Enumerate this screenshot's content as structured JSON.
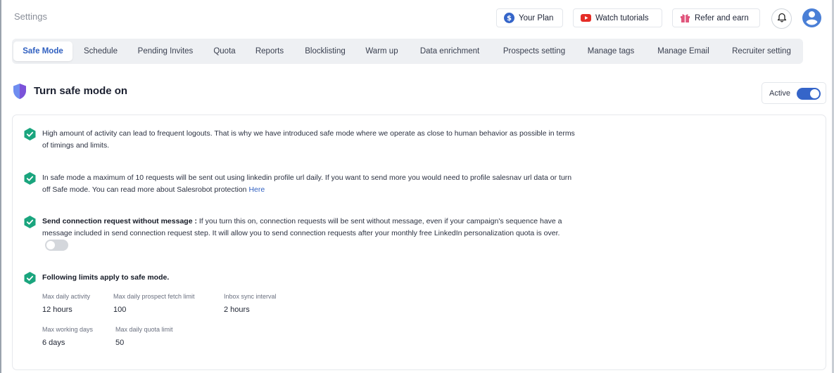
{
  "header": {
    "title": "Settings",
    "your_plan": "Your Plan",
    "watch_tutorials": "Watch tutorials",
    "refer_and_earn": "Refer and earn"
  },
  "tabs": [
    {
      "label": "Safe Mode",
      "active": true
    },
    {
      "label": "Schedule"
    },
    {
      "label": "Pending Invites"
    },
    {
      "label": "Quota"
    },
    {
      "label": "Reports"
    },
    {
      "label": "Blocklisting"
    },
    {
      "label": "Warm up"
    },
    {
      "label": "Data enrichment"
    },
    {
      "label": "Prospects setting"
    },
    {
      "label": "Manage tags"
    },
    {
      "label": "Manage Email"
    },
    {
      "label": "Recruiter setting"
    }
  ],
  "section": {
    "title": "Turn safe mode on",
    "status_label": "Active",
    "status_on": true
  },
  "items": {
    "item1": "High amount of activity can lead to frequent logouts. That is why we have introduced safe mode where we operate as close to human behavior as possible in terms of timings and limits.",
    "item2_text": "In safe mode a maximum of 10 requests will be sent out using linkedin profile url daily. If you want to send more you would need to profile salesnav url data or turn off Safe mode. You can read more about Salesrobot protection",
    "item2_link": "Here",
    "item3_bold": "Send connection request without message :",
    "item3_text": " If you turn this on, connection requests will be sent without message, even if your campaign's sequence have a message included in send connection request step. It will allow you to send connection requests after your monthly free LinkedIn personalization quota is over.",
    "item3_toggle_on": false,
    "item4_title": "Following limits apply to safe mode."
  },
  "limits": {
    "max_daily_activity_label": "Max daily activity",
    "max_daily_activity": "12 hours",
    "max_prospect_fetch_label": "Max daily prospect fetch limit",
    "max_prospect_fetch": "100",
    "inbox_sync_label": "Inbox sync interval",
    "inbox_sync": "2 hours",
    "max_working_days_label": "Max working days",
    "max_working_days": "6 days",
    "max_quota_label": "Max daily quota limit",
    "max_quota": "50"
  },
  "colors": {
    "accent": "#3565c9",
    "check_green": "#1aa57e",
    "youtube_red": "#e52d27",
    "gift_pink": "#e0557c"
  }
}
